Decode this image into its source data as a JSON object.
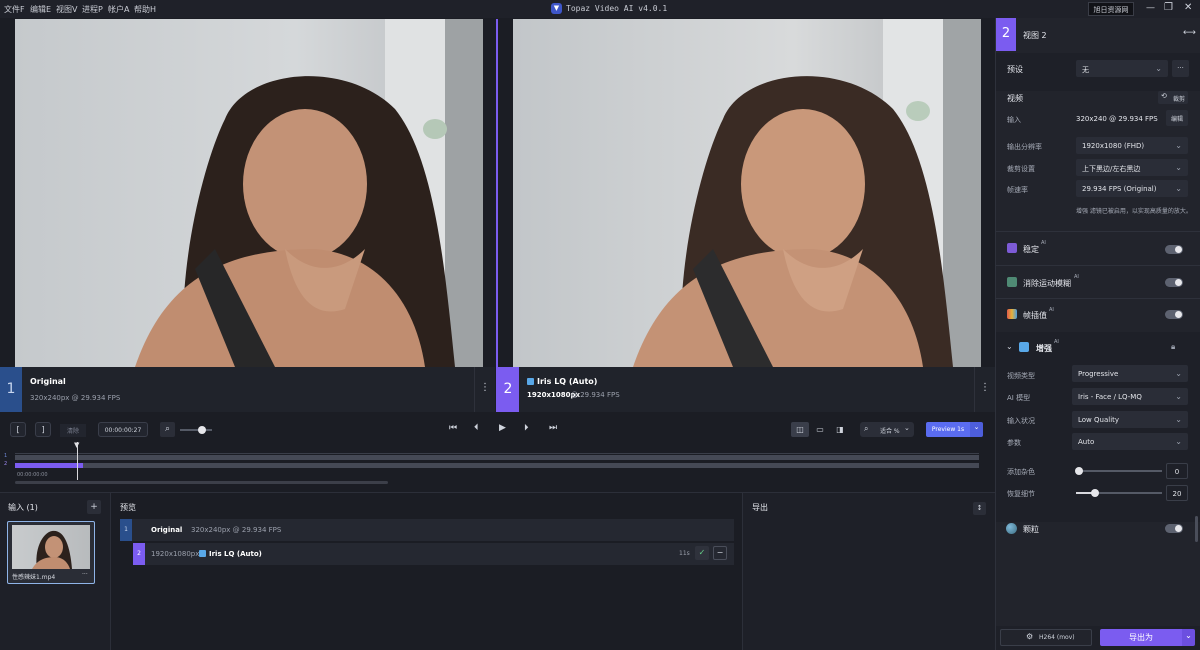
{
  "menu": [
    "文件F",
    "编辑E",
    "视图V",
    "进程P",
    "帐户A",
    "帮助H"
  ],
  "app_title": "Topaz Video AI  v4.0.1",
  "header_btn": "旭日资源网",
  "left_view": {
    "num": "1",
    "title": "Original",
    "meta": "320x240px @ 29.934 FPS"
  },
  "right_view": {
    "num": "2",
    "title": "Iris LQ (Auto)",
    "res": "1920x1080px",
    "meta": "@ 29.934 FPS"
  },
  "controls": {
    "bracket_in": "[",
    "bracket_out": "]",
    "clear": "清除",
    "timecode": "00:00:00:27",
    "fit_label": "适合 %",
    "preview_btn": "Preview 1s"
  },
  "timeline": {
    "track1": "1",
    "track2": "2",
    "time": "00:00:00:00"
  },
  "input_panel": {
    "title": "输入 (1)",
    "add": "+",
    "file": "性感辣妹1.mp4",
    "more": "···"
  },
  "preview_panel": {
    "title": "预览",
    "row1_num": "1",
    "row1_title": "Original",
    "row1_meta": "320x240px @ 29.934 FPS",
    "row2_num": "2",
    "row2_res": "1920x1080px",
    "row2_title": "Iris LQ (Auto)",
    "row2_time": "11s"
  },
  "export_panel": {
    "title": "导出"
  },
  "side": {
    "view_num": "2",
    "view_title": "视图 2",
    "preset_label": "预设",
    "preset_value": "无",
    "video_label": "视频",
    "crop_btn": "裁剪",
    "input_label": "输入",
    "input_value": "320x240 @ 29.934 FPS",
    "edit_btn": "编辑",
    "out_res_label": "输出分辨率",
    "out_res_value": "1920x1080 (FHD)",
    "crop_label": "裁剪设置",
    "crop_value": "上下黑边/左右黑边",
    "fps_label": "帧速率",
    "fps_value": "29.934 FPS (Original)",
    "note": "增强 滤镜已被启用，以实现高质量的放大。",
    "stab": "稳定",
    "motion": "消除运动模糊",
    "interp": "帧插值",
    "enhance": "增强",
    "grain": "颗粒",
    "ai": "AI",
    "vtype_label": "视频类型",
    "vtype_value": "Progressive",
    "model_label": "AI 模型",
    "model_value": "Iris - Face / LQ-MQ",
    "cond_label": "输入状况",
    "cond_value": "Low Quality",
    "param_label": "参数",
    "param_value": "Auto",
    "noise_label": "添加杂色",
    "noise_value": "0",
    "detail_label": "恢复细节",
    "detail_value": "20",
    "codec": "H264 (mov)",
    "export_btn": "导出为"
  },
  "colors": {
    "accent": "#7b5cf0",
    "view1": "#2a4f8c",
    "bg": "#1b1d24"
  }
}
